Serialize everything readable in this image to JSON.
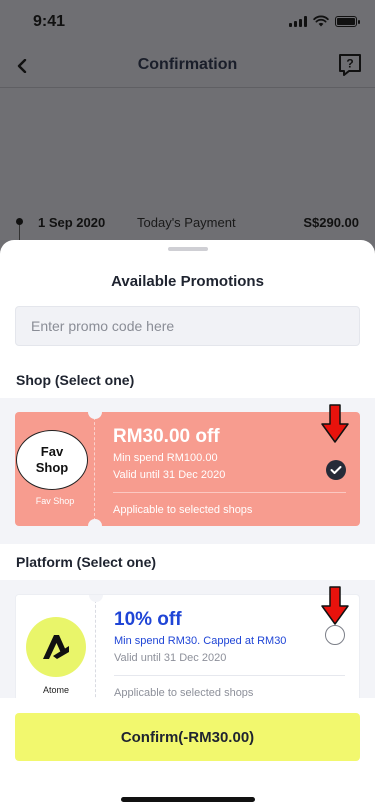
{
  "status_bar": {
    "time": "9:41"
  },
  "header": {
    "title": "Confirmation",
    "back_icon": "chevron-left-icon",
    "help_icon": "question-chat-icon"
  },
  "schedule": {
    "date": "1 Sep 2020",
    "label": "Today's Payment",
    "amount": "S$290.00"
  },
  "sheet": {
    "title": "Available Promotions",
    "promo_placeholder": "Enter promo code here",
    "shop_section": {
      "title": "Shop (Select one)",
      "coupon": {
        "merchant_logo_line1": "Fav",
        "merchant_logo_line2": "Shop",
        "merchant_name": "Fav Shop",
        "offer": "RM30.00 off",
        "min_spend": "Min spend RM100.00",
        "validity": "Valid until 31 Dec 2020",
        "applicability": "Applicable to selected shops",
        "selected": true,
        "card_color": "#f79c8f"
      }
    },
    "platform_section": {
      "title": "Platform (Select one)",
      "coupon": {
        "merchant_name": "Atome",
        "offer": "10% off",
        "min_spend": "Min spend RM30. Capped at RM30",
        "validity": "Valid until 31 Dec 2020",
        "applicability": "Applicable to selected shops",
        "selected": false,
        "accent_color": "#1f45d6",
        "logo_color": "#e9f56a"
      }
    },
    "confirm_label": "Confirm(-RM30.00)",
    "confirm_color": "#f2f86e"
  },
  "annotations": {
    "arrow_color": "#e8120c"
  }
}
